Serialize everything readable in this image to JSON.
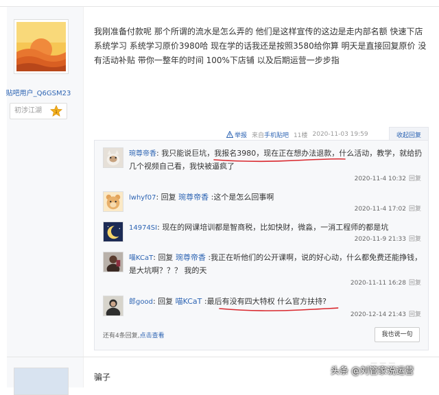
{
  "post": {
    "author": "贴吧用户_Q6GSM23",
    "level_title": "初涉江湖",
    "level_num": "1",
    "text": "我刚准备付款呢 那个所谓的流水是怎么弄的 他们是这样宣传的这边是走内部名额 快速下店系统学习 系统学习原价3980哈 现在学的话我还是按照3580给你算 明天是直接回复原价 没有活动补贴 带你一整年的时间 100%下店铺 以及后期运营一步步指",
    "report": "举报",
    "via_prefix": "来自",
    "via_link": "手机贴吧",
    "floor": "11楼",
    "time": "2020-11-03 19:59",
    "collapse": "收起回复"
  },
  "replies": [
    {
      "user": "琬尊帝香",
      "colon": ": ",
      "reply_label": "",
      "target": "",
      "text": "我只能说巨坑，我报名3980，现在正在想办法退款，什么活动，教学，就给扔几个视频自己看，我快被逼疯了",
      "time": "2020-11-4 10:32",
      "action": "回复"
    },
    {
      "user": "lwhyf07",
      "colon": ": ",
      "reply_label": "回复 ",
      "target": "琬尊帝香",
      "text": " :这个是怎么回事啊",
      "time": "2020-11-4 17:02",
      "action": "回复"
    },
    {
      "user": "14974SI",
      "colon": ": ",
      "reply_label": "",
      "target": "",
      "text": "现在的网课培训都是智商税，比如快财，微淼，一消工程师的都是坑",
      "time": "2020-11-9 21:33",
      "action": "回复"
    },
    {
      "user": "喵KCaT",
      "colon": ": ",
      "reply_label": "回复 ",
      "target": "琬尊帝香",
      "text": " :我正在听他们的公开课啊，说的好心动，什么都免费还能挣钱，是大坑啊？？？ 我的天",
      "time": "2020-11-11 16:28",
      "action": "回复"
    },
    {
      "user": "郎good",
      "colon": ": ",
      "reply_label": "回复 ",
      "target": "喵KCaT",
      "text": " :最后有没有四大特权 什么官方扶持?",
      "time": "2020-12-14 21:43",
      "action": "回复"
    }
  ],
  "more": {
    "prefix": "还有4条回复,",
    "link": "点击查看"
  },
  "say_button": "我也说一句",
  "post2": {
    "text": "骗子"
  },
  "watermark": "头条 @刘管家说运营",
  "ghost": "— — —",
  "colors": {
    "link": "#2d64b3",
    "annotation_red": "#d9262c",
    "panel_bg": "#f7f8fa"
  }
}
